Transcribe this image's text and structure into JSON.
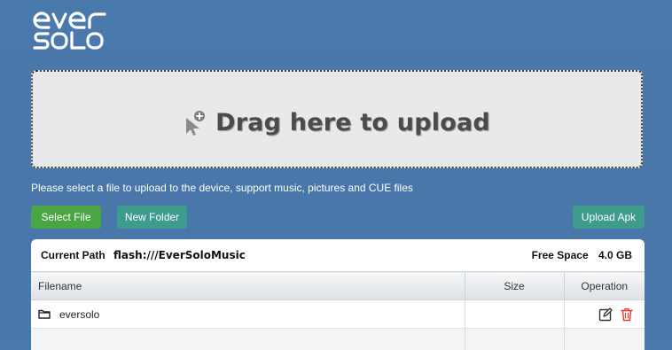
{
  "brand": {
    "logo_line1": "ever",
    "logo_line2": "SOLO"
  },
  "upload": {
    "drop_label": "Drag here to upload",
    "hint": "Please select a file to upload to the device, support music, pictures and CUE files",
    "icon": "cursor-plus-icon"
  },
  "buttons": {
    "select_file": "Select File",
    "new_folder": "New Folder",
    "upload_apk": "Upload Apk"
  },
  "path_bar": {
    "current_path_label": "Current Path",
    "current_path": "flash:///EverSoloMusic",
    "free_space_label": "Free Space",
    "free_space": "4.0 GB"
  },
  "table": {
    "columns": [
      "Filename",
      "Size",
      "Operation"
    ],
    "rows": [
      {
        "name": "eversolo",
        "size": "",
        "type": "folder",
        "icons": [
          "folder-icon",
          "edit-icon",
          "trash-icon"
        ]
      }
    ]
  },
  "colors": {
    "background": "#4a78aa",
    "select_button": "#4aa543",
    "secondary_button": "#3d9c8e",
    "delete_icon": "#e53935"
  }
}
